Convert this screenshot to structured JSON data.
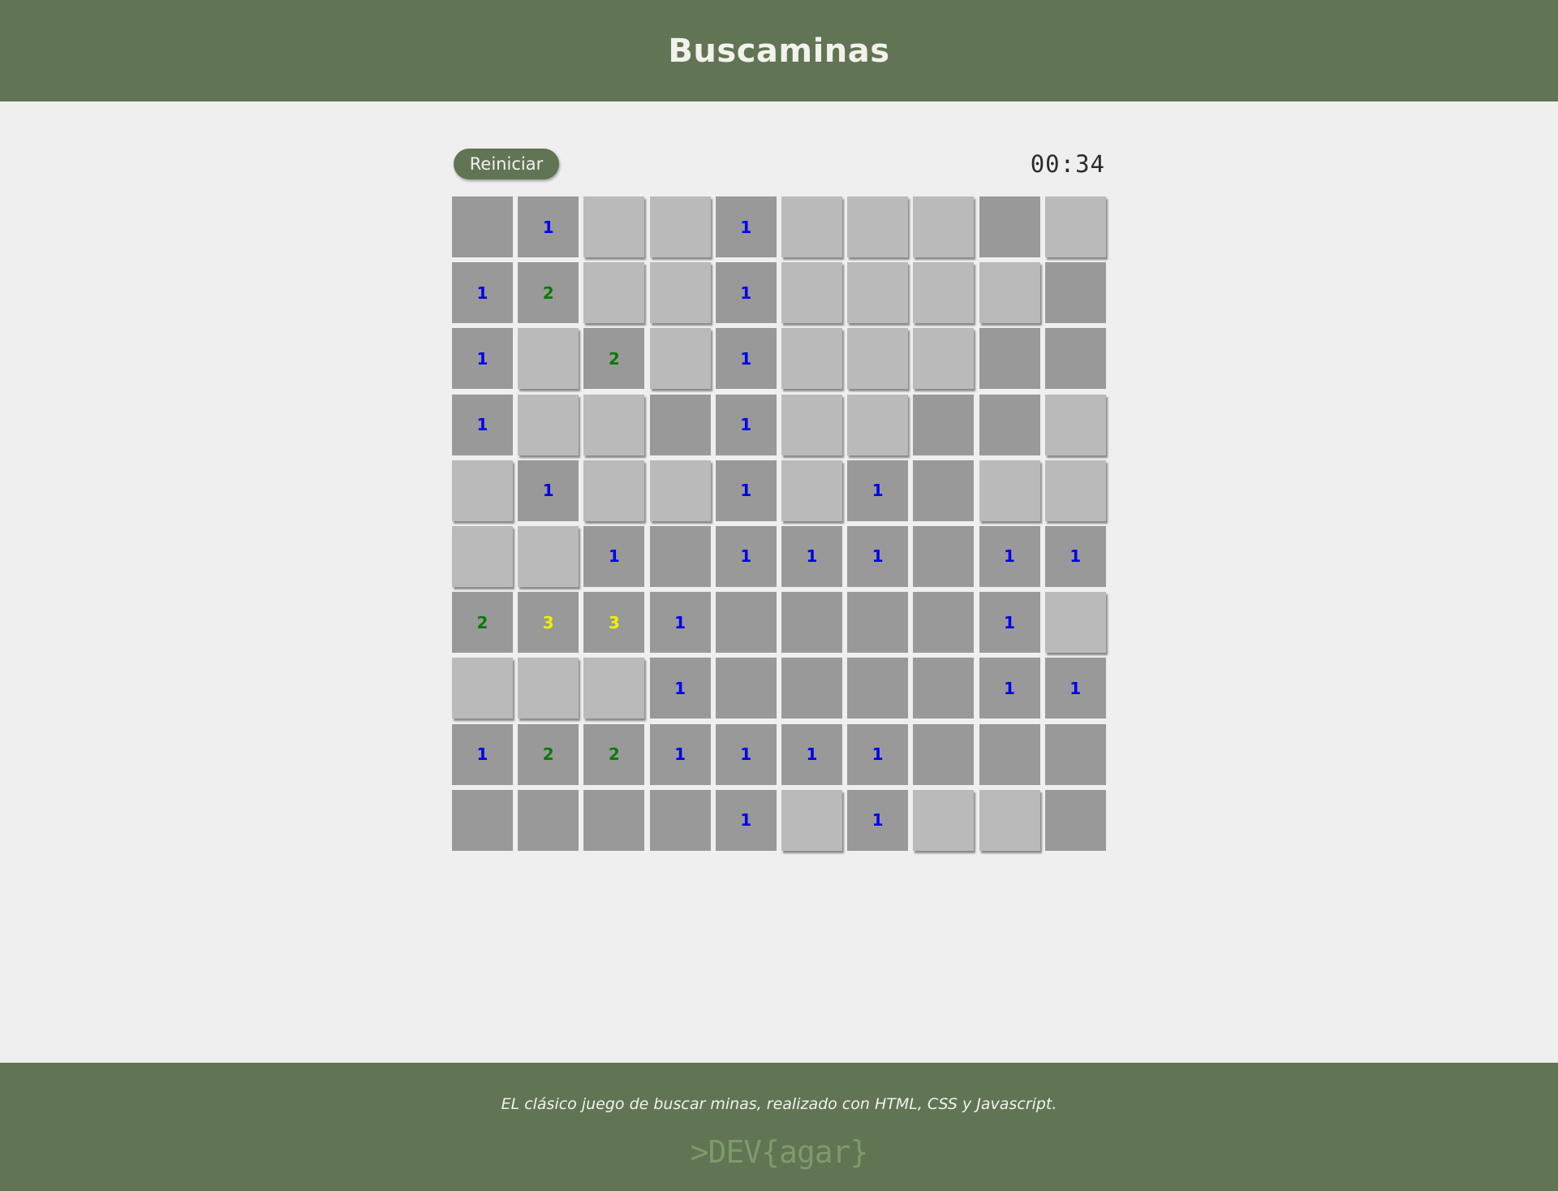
{
  "header": {
    "title": "Buscaminas"
  },
  "controls": {
    "restart_label": "Reiniciar",
    "timer": "00:34"
  },
  "board": {
    "rows": [
      [
        {
          "o": 1,
          "v": ""
        },
        {
          "o": 1,
          "v": "1"
        },
        {
          "o": 0,
          "v": ""
        },
        {
          "o": 0,
          "v": ""
        },
        {
          "o": 1,
          "v": "1"
        },
        {
          "o": 0,
          "v": ""
        },
        {
          "o": 0,
          "v": ""
        },
        {
          "o": 0,
          "v": ""
        },
        {
          "o": 1,
          "v": ""
        },
        {
          "o": 0,
          "v": ""
        }
      ],
      [
        {
          "o": 1,
          "v": "1"
        },
        {
          "o": 1,
          "v": "2"
        },
        {
          "o": 0,
          "v": ""
        },
        {
          "o": 0,
          "v": ""
        },
        {
          "o": 1,
          "v": "1"
        },
        {
          "o": 0,
          "v": ""
        },
        {
          "o": 0,
          "v": ""
        },
        {
          "o": 0,
          "v": ""
        },
        {
          "o": 0,
          "v": ""
        },
        {
          "o": 1,
          "v": ""
        }
      ],
      [
        {
          "o": 1,
          "v": "1"
        },
        {
          "o": 0,
          "v": ""
        },
        {
          "o": 1,
          "v": "2"
        },
        {
          "o": 0,
          "v": ""
        },
        {
          "o": 1,
          "v": "1"
        },
        {
          "o": 0,
          "v": ""
        },
        {
          "o": 0,
          "v": ""
        },
        {
          "o": 0,
          "v": ""
        },
        {
          "o": 1,
          "v": ""
        },
        {
          "o": 1,
          "v": ""
        }
      ],
      [
        {
          "o": 1,
          "v": "1"
        },
        {
          "o": 0,
          "v": ""
        },
        {
          "o": 0,
          "v": ""
        },
        {
          "o": 1,
          "v": ""
        },
        {
          "o": 1,
          "v": "1"
        },
        {
          "o": 0,
          "v": ""
        },
        {
          "o": 0,
          "v": ""
        },
        {
          "o": 1,
          "v": ""
        },
        {
          "o": 1,
          "v": ""
        },
        {
          "o": 0,
          "v": ""
        }
      ],
      [
        {
          "o": 0,
          "v": ""
        },
        {
          "o": 1,
          "v": "1"
        },
        {
          "o": 0,
          "v": ""
        },
        {
          "o": 0,
          "v": ""
        },
        {
          "o": 1,
          "v": "1"
        },
        {
          "o": 0,
          "v": ""
        },
        {
          "o": 1,
          "v": "1"
        },
        {
          "o": 1,
          "v": ""
        },
        {
          "o": 0,
          "v": ""
        },
        {
          "o": 0,
          "v": ""
        }
      ],
      [
        {
          "o": 0,
          "v": ""
        },
        {
          "o": 0,
          "v": ""
        },
        {
          "o": 1,
          "v": "1"
        },
        {
          "o": 1,
          "v": ""
        },
        {
          "o": 1,
          "v": "1"
        },
        {
          "o": 1,
          "v": "1"
        },
        {
          "o": 1,
          "v": "1"
        },
        {
          "o": 1,
          "v": ""
        },
        {
          "o": 1,
          "v": "1"
        },
        {
          "o": 1,
          "v": "1"
        }
      ],
      [
        {
          "o": 1,
          "v": "2"
        },
        {
          "o": 1,
          "v": "3"
        },
        {
          "o": 1,
          "v": "3"
        },
        {
          "o": 1,
          "v": "1"
        },
        {
          "o": 1,
          "v": ""
        },
        {
          "o": 1,
          "v": ""
        },
        {
          "o": 1,
          "v": ""
        },
        {
          "o": 1,
          "v": ""
        },
        {
          "o": 1,
          "v": "1"
        },
        {
          "o": 0,
          "v": ""
        }
      ],
      [
        {
          "o": 0,
          "v": ""
        },
        {
          "o": 0,
          "v": ""
        },
        {
          "o": 0,
          "v": ""
        },
        {
          "o": 1,
          "v": "1"
        },
        {
          "o": 1,
          "v": ""
        },
        {
          "o": 1,
          "v": ""
        },
        {
          "o": 1,
          "v": ""
        },
        {
          "o": 1,
          "v": ""
        },
        {
          "o": 1,
          "v": "1"
        },
        {
          "o": 1,
          "v": "1"
        }
      ],
      [
        {
          "o": 1,
          "v": "1"
        },
        {
          "o": 1,
          "v": "2"
        },
        {
          "o": 1,
          "v": "2"
        },
        {
          "o": 1,
          "v": "1"
        },
        {
          "o": 1,
          "v": "1"
        },
        {
          "o": 1,
          "v": "1"
        },
        {
          "o": 1,
          "v": "1"
        },
        {
          "o": 1,
          "v": ""
        },
        {
          "o": 1,
          "v": ""
        },
        {
          "o": 1,
          "v": ""
        }
      ],
      [
        {
          "o": 1,
          "v": ""
        },
        {
          "o": 1,
          "v": ""
        },
        {
          "o": 1,
          "v": ""
        },
        {
          "o": 1,
          "v": ""
        },
        {
          "o": 1,
          "v": "1"
        },
        {
          "o": 0,
          "v": ""
        },
        {
          "o": 1,
          "v": "1"
        },
        {
          "o": 0,
          "v": ""
        },
        {
          "o": 0,
          "v": ""
        },
        {
          "o": 1,
          "v": ""
        }
      ]
    ]
  },
  "colors": {
    "brand": "#617454",
    "open_cell": "#999999",
    "closed_cell": "#bababa",
    "number_1": "#0000ee",
    "number_2": "#0a7a0a",
    "number_3": "#f0f000"
  },
  "footer": {
    "text": "EL clásico juego de buscar minas, realizado con HTML, CSS y Javascript.",
    "logo": ">DEV{agar}"
  }
}
